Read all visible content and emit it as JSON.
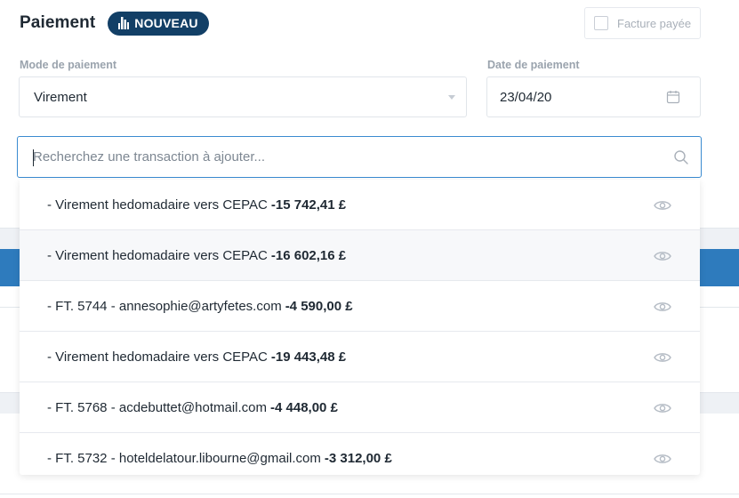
{
  "header": {
    "title": "Paiement",
    "badge": "NOUVEAU",
    "badge_color": "#123f66"
  },
  "paid_checkbox": {
    "label": "Facture payée",
    "checked": false
  },
  "payment_mode": {
    "label": "Mode de paiement",
    "value": "Virement"
  },
  "payment_date": {
    "label": "Date de paiement",
    "value": "23/04/20",
    "icon": "calendar-icon"
  },
  "search": {
    "placeholder": "Recherchez une transaction à ajouter...",
    "icon": "search-icon",
    "border_color": "#3a8bd0"
  },
  "transactions": [
    {
      "label": "- Virement hedomadaire vers CEPAC",
      "amount": "-15 742,41 £"
    },
    {
      "label": "- Virement hedomadaire vers CEPAC",
      "amount": "-16 602,16 £"
    },
    {
      "label": "- FT. 5744 - annesophie@artyfetes.com",
      "amount": "-4 590,00 £"
    },
    {
      "label": "- Virement hedomadaire vers CEPAC",
      "amount": "-19 443,48 £"
    },
    {
      "label": "- FT. 5768 - acdebuttet@hotmail.com",
      "amount": "-4 448,00 £"
    },
    {
      "label": "- FT. 5732 - hoteldelatour.libourne@gmail.com",
      "amount": "-3 312,00 £"
    }
  ]
}
